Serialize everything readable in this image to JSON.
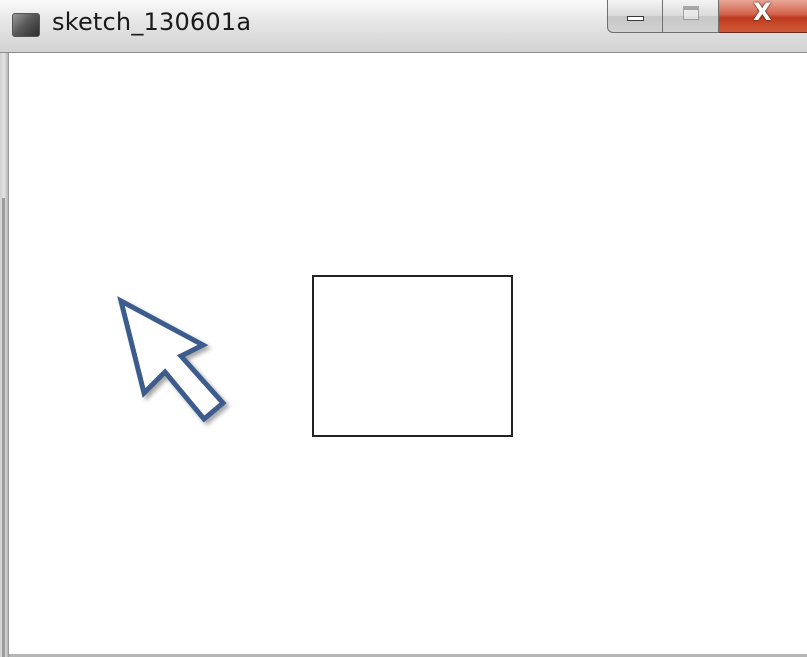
{
  "window": {
    "title": "sketch_130601a",
    "controls": {
      "minimize_icon": "minimize-icon",
      "maximize_icon": "maximize-icon",
      "close_icon": "close-icon",
      "close_glyph": "X"
    }
  },
  "canvas": {
    "background": "#ffffff",
    "shapes": [
      {
        "type": "rectangle",
        "stroke": "#222222",
        "fill": "none"
      }
    ],
    "annotation": {
      "icon": "arrow-pointer-icon",
      "stroke": "#3b5c8c",
      "fill": "#ffffff"
    }
  },
  "colors": {
    "close_button": "#c8462a",
    "titlebar": "#e3e3e3"
  }
}
